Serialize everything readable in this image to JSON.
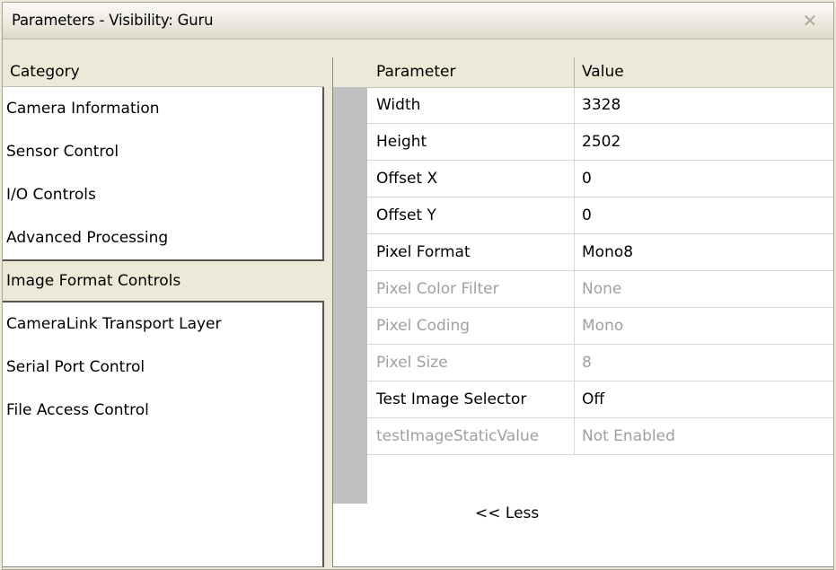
{
  "window": {
    "title": "Parameters - Visibility: Guru",
    "close_glyph": "✕"
  },
  "categories": {
    "header": "Category",
    "items": [
      {
        "label": "Camera Information",
        "selected": false
      },
      {
        "label": "Sensor Control",
        "selected": false
      },
      {
        "label": "I/O Controls",
        "selected": false
      },
      {
        "label": "Advanced Processing",
        "selected": false
      },
      {
        "label": "Image Format Controls",
        "selected": true
      },
      {
        "label": "CameraLink Transport Layer",
        "selected": false
      },
      {
        "label": "Serial Port Control",
        "selected": false
      },
      {
        "label": "File Access Control",
        "selected": false
      }
    ]
  },
  "parameters": {
    "header_parameter": "Parameter",
    "header_value": "Value",
    "rows": [
      {
        "name": "Width",
        "value": "3328",
        "enabled": true
      },
      {
        "name": "Height",
        "value": "2502",
        "enabled": true
      },
      {
        "name": "Offset X",
        "value": "0",
        "enabled": true
      },
      {
        "name": "Offset Y",
        "value": "0",
        "enabled": true
      },
      {
        "name": "Pixel Format",
        "value": "Mono8",
        "enabled": true
      },
      {
        "name": "Pixel Color Filter",
        "value": "None",
        "enabled": false
      },
      {
        "name": "Pixel Coding",
        "value": "Mono",
        "enabled": false
      },
      {
        "name": "Pixel Size",
        "value": "8",
        "enabled": false
      },
      {
        "name": "Test Image Selector",
        "value": "Off",
        "enabled": true
      },
      {
        "name": "testImageStaticValue",
        "value": "Not Enabled",
        "enabled": false
      }
    ],
    "less_label": "<< Less"
  }
}
